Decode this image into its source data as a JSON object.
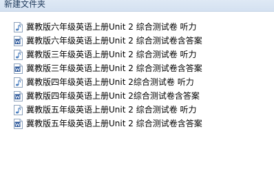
{
  "window": {
    "title": "新建文件夹"
  },
  "files": [
    {
      "name": "冀教版六年级英语上册Unit 2 综合测试卷 听力",
      "icon": "audio-file-icon"
    },
    {
      "name": "冀教版六年级英语上册Unit 2 综合测试卷含答案",
      "icon": "word-document-icon"
    },
    {
      "name": "冀教版三年级英语上册Unit 2 综合测试卷 听力",
      "icon": "audio-file-icon"
    },
    {
      "name": "冀教版三年级英语上册Unit 2 综合测试卷含答案",
      "icon": "word-document-icon"
    },
    {
      "name": "冀教版四年级英语上册Unit 2综合测试卷 听力",
      "icon": "audio-file-icon"
    },
    {
      "name": "冀教版四年级英语上册Unit 2综合测试卷含答案",
      "icon": "word-document-icon"
    },
    {
      "name": "冀教版五年级英语上册Unit 2 综合测试卷 听力",
      "icon": "audio-file-icon"
    },
    {
      "name": "冀教版五年级英语上册Unit 2 综合测试卷含答案",
      "icon": "word-document-icon"
    }
  ],
  "colors": {
    "title_bar": "#d4e1f1",
    "audio_icon": "#4a7fc1",
    "word_icon": "#2b579a"
  }
}
